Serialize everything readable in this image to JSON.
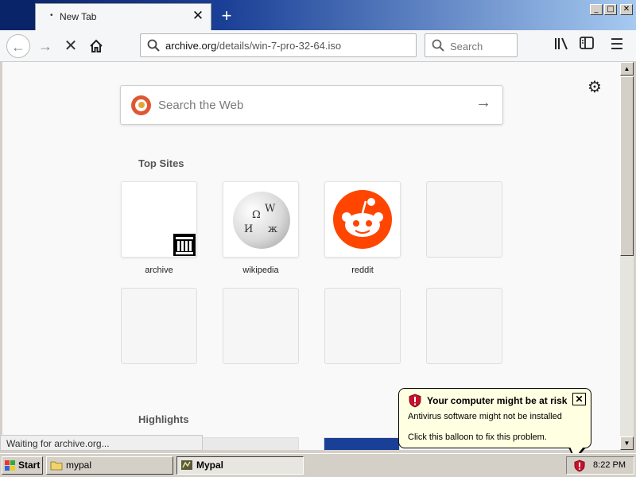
{
  "window": {
    "tab_title": "New Tab",
    "tab_close": "✕",
    "new_tab": "+",
    "minimize": "_",
    "maximize": "□",
    "close": "✕"
  },
  "toolbar": {
    "url_domain": "archive.org",
    "url_path": "/details/win-7-pro-32-64.iso",
    "search_placeholder": "Search"
  },
  "newtab": {
    "search_placeholder": "Search the Web",
    "top_sites_title": "Top Sites",
    "highlights_title": "Highlights",
    "top_sites": [
      {
        "label": "archive"
      },
      {
        "label": "wikipedia"
      },
      {
        "label": "reddit"
      },
      {
        "label": ""
      }
    ]
  },
  "status": {
    "text": "Waiting for archive.org..."
  },
  "taskbar": {
    "start_label": "Start",
    "items": [
      {
        "label": "mypal",
        "active": false
      },
      {
        "label": "Mypal",
        "active": true
      }
    ],
    "clock": "8:22 PM"
  },
  "balloon": {
    "title": "Your computer might be at risk",
    "line1": "Antivirus software might not be installed",
    "line2": "Click this balloon to fix this problem.",
    "close": "✕"
  },
  "colors": {
    "reddit": "#ff4500",
    "duckduckgo": "#de5833",
    "balloon_bg": "#ffffe1",
    "titlebar": "#0a246a"
  }
}
